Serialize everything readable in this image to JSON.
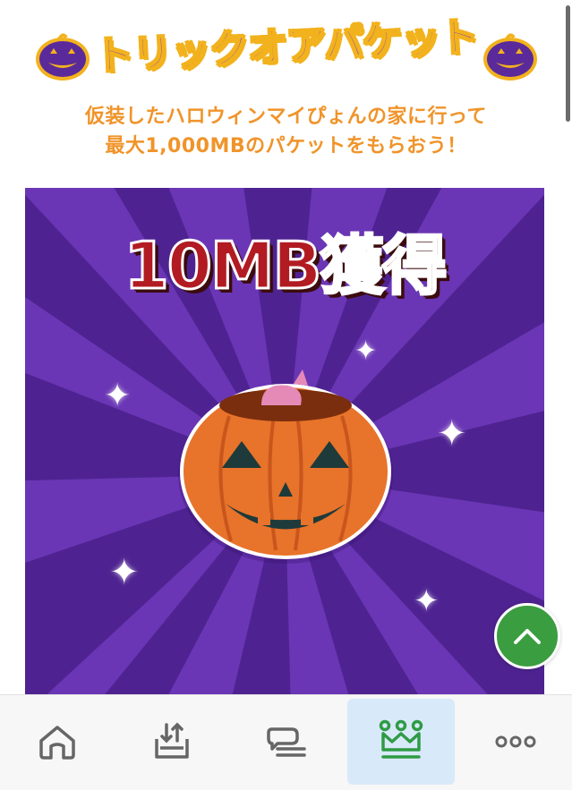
{
  "header": {
    "title": "トリックオアパケット",
    "subtitle_line1": "仮装したハロウィンマイぴょんの家に行って",
    "subtitle_line2": "最大1,000MBのパケットをもらおう！"
  },
  "banner": {
    "reward_text": "10MB獲得"
  },
  "colors": {
    "title_purple": "#7b2fc9",
    "title_outline": "#f2b21d",
    "subtitle_orange": "#f0942a",
    "banner_purple": "#5a2a9e",
    "reward_red": "#b21b22",
    "pumpkin_orange": "#e8732a",
    "to_top_green": "#3a9d3f",
    "active_nav_bg": "#d8eaf9",
    "active_nav_icon": "#2f9b45"
  },
  "bottom_nav": {
    "items": [
      {
        "icon": "home-icon",
        "active": false
      },
      {
        "icon": "download-tray-icon",
        "active": false
      },
      {
        "icon": "chat-lines-icon",
        "active": false
      },
      {
        "icon": "crown-icon",
        "active": true
      },
      {
        "icon": "more-dots-icon",
        "active": false
      }
    ]
  }
}
